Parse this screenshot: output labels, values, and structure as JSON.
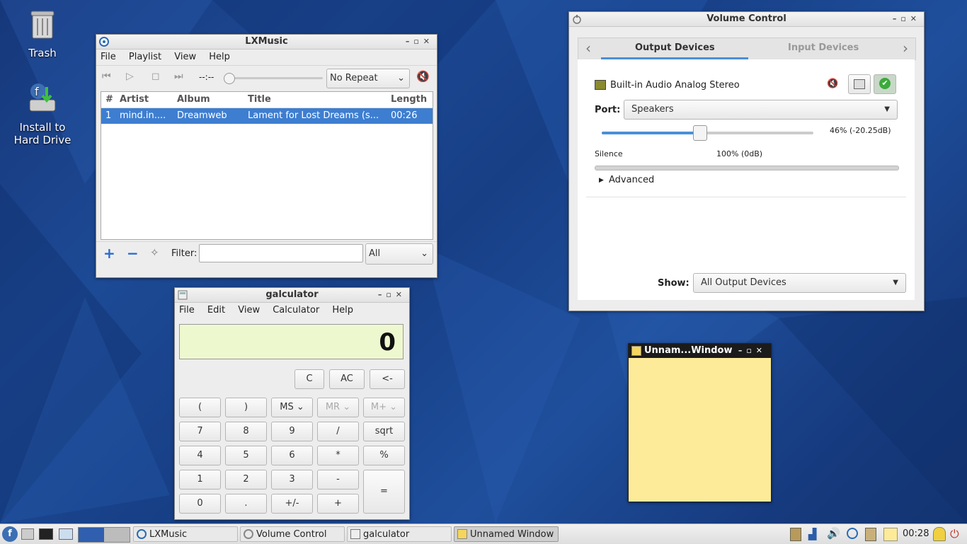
{
  "desktop": {
    "trash_label": "Trash",
    "install_label_1": "Install to",
    "install_label_2": "Hard Drive"
  },
  "lxmusic": {
    "title": "LXMusic",
    "menu": [
      "File",
      "Playlist",
      "View",
      "Help"
    ],
    "time": "--:--",
    "repeat_value": "No Repeat",
    "columns": [
      "#",
      "Artist",
      "Album",
      "Title",
      "Length"
    ],
    "rows": [
      {
        "num": "1",
        "artist": "mind.in....",
        "album": "Dreamweb",
        "title": "Lament for Lost Dreams (s...",
        "length": "00:26"
      }
    ],
    "filter_label": "Filter:",
    "filter_value": "",
    "filter_scope": "All"
  },
  "volume": {
    "title": "Volume Control",
    "tab_output": "Output Devices",
    "tab_input": "Input Devices",
    "device_name": "Built-in Audio Analog Stereo",
    "port_label": "Port:",
    "port_value": "Speakers",
    "volume_readout": "46% (-20.25dB)",
    "volume_level": 0.46,
    "silence_label": "Silence",
    "full_label": "100% (0dB)",
    "advanced_label": "Advanced",
    "show_label": "Show:",
    "show_value": "All Output Devices"
  },
  "calculator": {
    "title": "galculator",
    "menu": [
      "File",
      "Edit",
      "View",
      "Calculator",
      "Help"
    ],
    "display": "0",
    "keys": {
      "c": "C",
      "ac": "AC",
      "back": "<-",
      "lparen": "(",
      "rparen": ")",
      "ms": "MS",
      "mr": "MR",
      "mplus": "M+",
      "k7": "7",
      "k8": "8",
      "k9": "9",
      "div": "/",
      "sqrt": "sqrt",
      "k4": "4",
      "k5": "5",
      "k6": "6",
      "mul": "*",
      "pct": "%",
      "k1": "1",
      "k2": "2",
      "k3": "3",
      "sub": "-",
      "eq": "=",
      "k0": "0",
      "dot": ".",
      "sign": "+/-",
      "add": "+"
    }
  },
  "note": {
    "title": "Unnam...Window"
  },
  "taskbar": {
    "tasks": [
      "LXMusic",
      "Volume Control",
      "galculator",
      "Unnamed Window"
    ],
    "clock": "00:28"
  },
  "colors": {
    "selection": "#3d7ed1",
    "lcd": "#eef8cf",
    "note": "#fdeb9a",
    "accent_tab": "#4a90d9"
  }
}
